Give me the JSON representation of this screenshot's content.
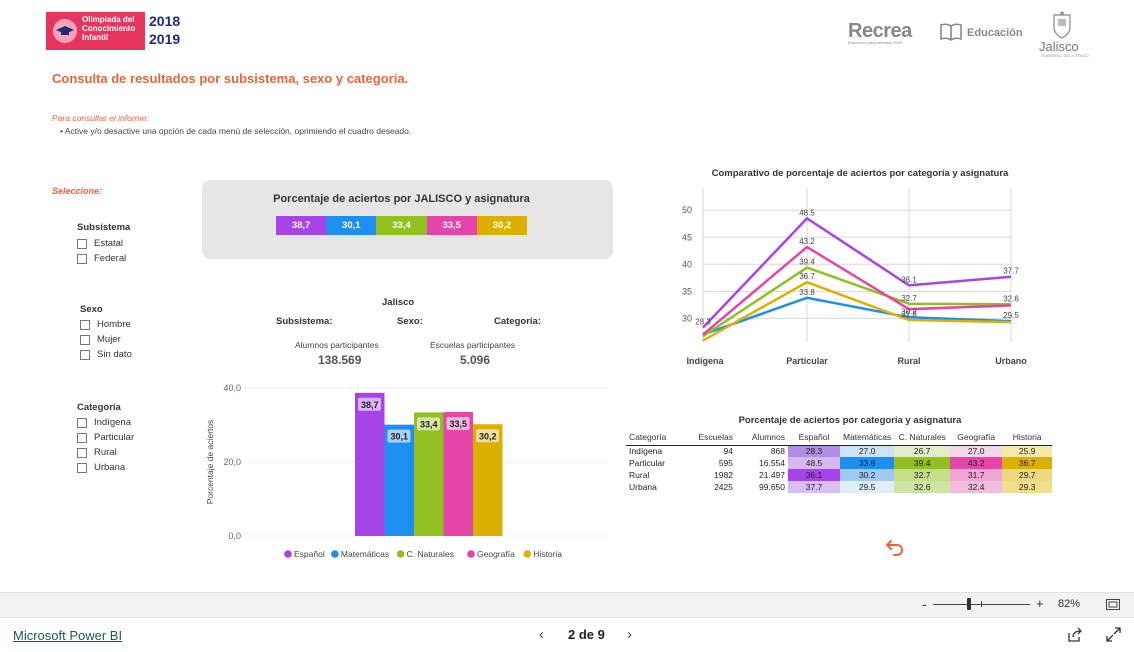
{
  "header": {
    "logo_line1": "Olimpiada del",
    "logo_line2": "Conocimiento",
    "logo_line3": "Infantil",
    "year1": "2018",
    "year2": "2019",
    "recrea": "Recrea",
    "recrea_sub": "Educación para refundar 2030",
    "educacion": "Educación",
    "jalisco": "Jalisco",
    "jalisco_sub": "GOBIERNO DEL ESTADO"
  },
  "page_title": "Consulta de resultados por subsistema, sexo y categoría.",
  "instructions": {
    "heading": "Para consultar el informe:",
    "bullet": "• Active y/o desactive una opción de cada menú de selección, oprimiendo el cuadro deseado."
  },
  "select_label": "Seleccione:",
  "slicers": {
    "subsistema": {
      "title": "Subsistema",
      "options": [
        "Estatal",
        "Federal"
      ]
    },
    "sexo": {
      "title": "Sexo",
      "options": [
        "Hombre",
        "Mujer",
        "Sin dato"
      ]
    },
    "categoria": {
      "title": "Categoría",
      "options": [
        "Indígena",
        "Particular",
        "Rural",
        "Urbana"
      ]
    }
  },
  "summary_card": {
    "title": "Porcentaje de aciertos por JALISCO y asignatura",
    "values": [
      "38,7",
      "30,1",
      "33,4",
      "33,5",
      "30,2"
    ]
  },
  "colors": {
    "espanol": "#a744e8",
    "matematicas": "#1e8ff0",
    "naturales": "#92c020",
    "geografia": "#e346a8",
    "historia": "#dcb000",
    "accent": "#e8643c"
  },
  "middle": {
    "jalisco": "Jalisco",
    "subsistema": "Subsistema:",
    "sexo": "Sexo:",
    "categoria": "Categoría:",
    "alumnos_label": "Alumnos participantes",
    "alumnos_value": "138.569",
    "escuelas_label": "Escuelas participantes",
    "escuelas_value": "5.096"
  },
  "chart_data": [
    {
      "type": "bar",
      "title": "",
      "ylabel": "Porcentaje de aciertos",
      "ylim": [
        0,
        40
      ],
      "y_ticks": [
        "0,0",
        "20,0",
        "40,0"
      ],
      "series": [
        {
          "name": "Español",
          "values": [
            38.7
          ],
          "label": "38,7"
        },
        {
          "name": "Matemáticas",
          "values": [
            30.1
          ],
          "label": "30,1"
        },
        {
          "name": "C. Naturales",
          "values": [
            33.4
          ],
          "label": "33,4"
        },
        {
          "name": "Geografía",
          "values": [
            33.5
          ],
          "label": "33,5"
        },
        {
          "name": "Historia",
          "values": [
            30.2
          ],
          "label": "30,2"
        }
      ],
      "legend_position": "bottom",
      "grid": true
    },
    {
      "type": "line",
      "title": "Comparativo de porcentaje de aciertos por categoría y asignatura",
      "categories": [
        "Indígena",
        "Particular",
        "Rural",
        "Urbano"
      ],
      "y_ticks": [
        30,
        35,
        40,
        45,
        50
      ],
      "ylim": [
        26,
        53
      ],
      "series": [
        {
          "name": "Español",
          "values": [
            28.3,
            48.5,
            36.1,
            37.7
          ]
        },
        {
          "name": "Matemáticas",
          "values": [
            27.0,
            33.8,
            30.2,
            29.5
          ]
        },
        {
          "name": "C. Naturales",
          "values": [
            26.7,
            39.4,
            32.7,
            32.6
          ]
        },
        {
          "name": "Geografía",
          "values": [
            27.0,
            43.2,
            31.7,
            32.4
          ]
        },
        {
          "name": "Historia",
          "values": [
            25.9,
            36.7,
            29.7,
            29.3
          ]
        }
      ],
      "point_labels": [
        {
          "category": "Indígena",
          "value": 28.3,
          "text": "28.3"
        },
        {
          "category": "Particular",
          "value": 48.5,
          "text": "48.5"
        },
        {
          "category": "Particular",
          "value": 43.2,
          "text": "43.2"
        },
        {
          "category": "Particular",
          "value": 39.4,
          "text": "39.4"
        },
        {
          "category": "Particular",
          "value": 36.7,
          "text": "36.7"
        },
        {
          "category": "Particular",
          "value": 33.8,
          "text": "33.8"
        },
        {
          "category": "Rural",
          "value": 36.1,
          "text": "36.1"
        },
        {
          "category": "Rural",
          "value": 32.7,
          "text": "32.7"
        },
        {
          "category": "Rural",
          "value": 30.2,
          "text": "30.2"
        },
        {
          "category": "Rural",
          "value": 29.7,
          "text": "31.8"
        },
        {
          "category": "Urbano",
          "value": 37.7,
          "text": "37.7"
        },
        {
          "category": "Urbano",
          "value": 32.6,
          "text": "32.6"
        },
        {
          "category": "Urbano",
          "value": 29.5,
          "text": "29.5"
        }
      ],
      "grid": true
    },
    {
      "type": "table",
      "title": "Porcentaje de aciertos por categoría y asignatura",
      "columns": [
        "Categoría",
        "Escuelas",
        "Alumnos",
        "Español",
        "Matemáticas",
        "C. Naturales",
        "Geografía",
        "Historia"
      ],
      "rows": [
        [
          "Indígena",
          "94",
          "868",
          "28.3",
          "27.0",
          "26.7",
          "27.0",
          "25.9"
        ],
        [
          "Particular",
          "595",
          "16.554",
          "48.5",
          "33.8",
          "39.4",
          "43.2",
          "36.7"
        ],
        [
          "Rural",
          "1982",
          "21.497",
          "36.1",
          "30.2",
          "32.7",
          "31.7",
          "29.7"
        ],
        [
          "Urbana",
          "2425",
          "99.650",
          "37.7",
          "29.5",
          "32.6",
          "32.4",
          "29.3"
        ]
      ]
    }
  ],
  "footer": {
    "brand": "Microsoft Power BI",
    "page_indicator": "2 de 9",
    "prev_icon": "‹",
    "next_icon": "›",
    "zoom_minus": "-",
    "zoom_plus": "+",
    "zoom_level": "82%"
  }
}
